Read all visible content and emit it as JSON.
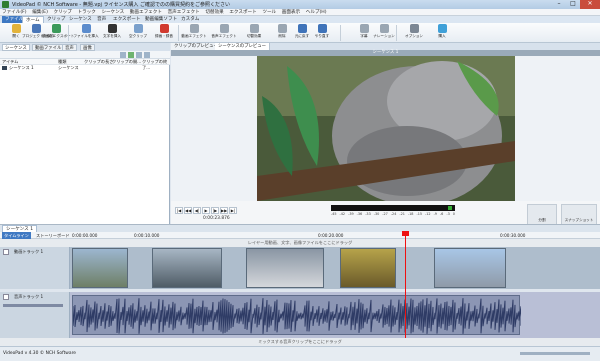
{
  "window": {
    "title": "VideoPad © NCH Software - 無題.vpj ライセンス購入 ご確認でのの購買契約をご参照ください",
    "minimize": "–",
    "maximize": "□",
    "close": "✕"
  },
  "menu": [
    "ファイル(F)",
    "編集(E)",
    "クリップ",
    "トラック",
    "シーケンス",
    "動画エフェクト",
    "音声エフェクト",
    "切替効果",
    "エクスポート",
    "ツール",
    "画面表示",
    "ヘルプ(H)"
  ],
  "tabs": [
    "ファイル",
    "ホーム",
    "クリップ",
    "シーケンス",
    "音声",
    "エクスポート",
    "動画編集ソフト",
    "カスタム"
  ],
  "ribbon": [
    {
      "label": "開く",
      "icon": "folder-icon",
      "color": "#e2b33b"
    },
    {
      "label": "プロジェクトを保存",
      "icon": "save-icon",
      "color": "#4a77b8"
    },
    {
      "label": "動画をエクスポート",
      "icon": "film-export-icon",
      "color": "#3b9a5b"
    },
    {
      "label": "ファイルを挿入",
      "icon": "add-file-icon",
      "color": "#5b8ccd"
    },
    {
      "label": "文字を挿入",
      "icon": "text-icon",
      "color": "#333333"
    },
    {
      "label": "空クリップ",
      "icon": "blank-clip-icon",
      "color": "#7aa0cc"
    },
    {
      "label": "録画・録音",
      "icon": "record-icon",
      "color": "#d13a2f"
    },
    {
      "label": "動画エフェクト",
      "icon": "video-effects-icon",
      "color": "#9aa6b2"
    },
    {
      "label": "音声エフェクト",
      "icon": "audio-effects-icon",
      "color": "#9aa6b2"
    },
    {
      "label": "切替効果",
      "icon": "transition-icon",
      "color": "#9aa6b2"
    },
    {
      "label": "削除",
      "icon": "delete-icon",
      "color": "#9aa6b2"
    },
    {
      "label": "元に戻す",
      "icon": "undo-icon",
      "color": "#3f73b9"
    },
    {
      "label": "やり直す",
      "icon": "redo-icon",
      "color": "#3f73b9"
    },
    {
      "label": "字幕",
      "icon": "caption-icon",
      "color": "#9aa6b2"
    },
    {
      "label": "ナレーション",
      "icon": "narration-icon",
      "color": "#9aa6b2"
    },
    {
      "label": "オプション",
      "icon": "options-icon",
      "color": "#7c8794"
    },
    {
      "label": "購入",
      "icon": "buy-icon",
      "color": "#3fa0d8"
    }
  ],
  "left_panel": {
    "tabs": [
      "シーケンス",
      "動画ファイル",
      "音声",
      "画像"
    ],
    "columns": [
      "アイテム",
      "種類",
      "クリップの長さ",
      "クリップの開...",
      "クリップの終了..."
    ],
    "rows": [
      {
        "name": "シーケンス 1",
        "type": "シーケンス"
      }
    ]
  },
  "preview": {
    "tabs": [
      "クリップのプレビュー",
      "シーケンスのプレビュー"
    ],
    "title": "シーケンス 1",
    "timecode": "0:00:23.876",
    "meter_labels": [
      "-45",
      "-42",
      "-39",
      "-36",
      "-33",
      "-30",
      "-27",
      "-24",
      "-21",
      "-18",
      "-15",
      "-12",
      "-9",
      "-6",
      "-3",
      "0"
    ],
    "side_buttons": [
      "分割",
      "スナップショット"
    ]
  },
  "timeline": {
    "tabs": [
      "シーケンス 1"
    ],
    "mode_tabs": [
      "タイムライン",
      "ストーリーボード"
    ],
    "ruler": [
      "0:00:00.000",
      "0:00:10.000",
      "0:00:20.000",
      "0:00:30.000"
    ],
    "overlay_hint": "レイヤー用動画、文字、画像ファイルをここにドラッグ",
    "video_track": "動画トラック 1",
    "audio_track": "音声トラック 1",
    "bottom_hint": "ミックスする音声クリップをここにドラッグ"
  },
  "status": {
    "text": "VideoPad v 4.30 © NCH Software"
  }
}
